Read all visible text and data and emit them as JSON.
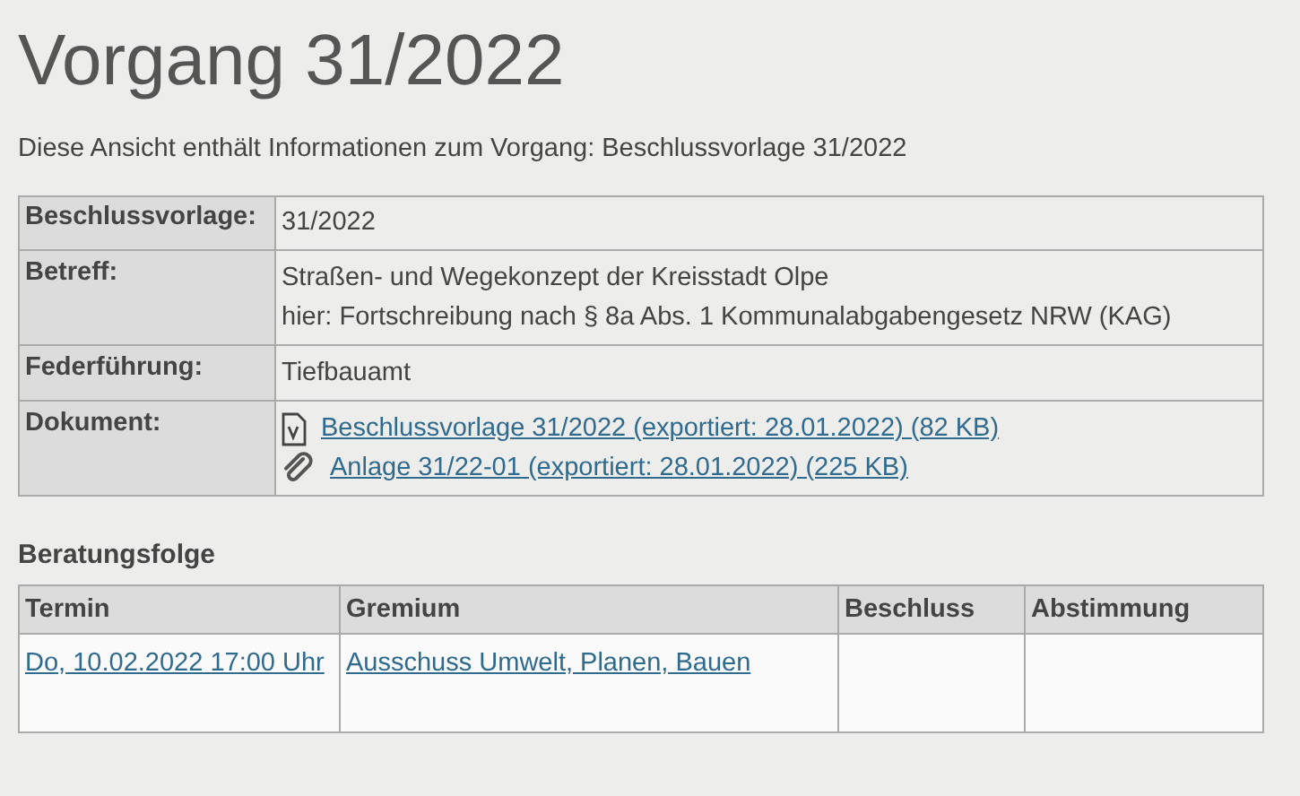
{
  "title": "Vorgang 31/2022",
  "intro": "Diese Ansicht enthält Informationen zum Vorgang: Beschlussvorlage 31/2022",
  "details": [
    {
      "label": "Beschlussvorlage:",
      "lines": [
        "31/2022"
      ]
    },
    {
      "label": "Betreff:",
      "lines": [
        "Straßen- und Wegekonzept der Kreisstadt Olpe",
        "hier: Fortschreibung nach § 8a Abs. 1 Kommunalabgabengesetz NRW (KAG)"
      ]
    },
    {
      "label": "Federführung:",
      "lines": [
        "Tiefbauamt"
      ]
    },
    {
      "label": "Dokument:",
      "documents": [
        {
          "kind": "document",
          "text": "Beschlussvorlage 31/2022 (exportiert: 28.01.2022) (82 KB)"
        },
        {
          "kind": "attachment",
          "text": "Anlage 31/22-01 (exportiert: 28.01.2022) (225 KB)"
        }
      ]
    }
  ],
  "sequence": {
    "heading": "Beratungsfolge",
    "columns": [
      "Termin",
      "Gremium",
      "Beschluss",
      "Abstimmung"
    ],
    "rows": [
      {
        "termin": "Do, 10.02.2022 17:00 Uhr",
        "gremium": "Ausschuss Umwelt, Planen, Bauen"
      }
    ]
  }
}
